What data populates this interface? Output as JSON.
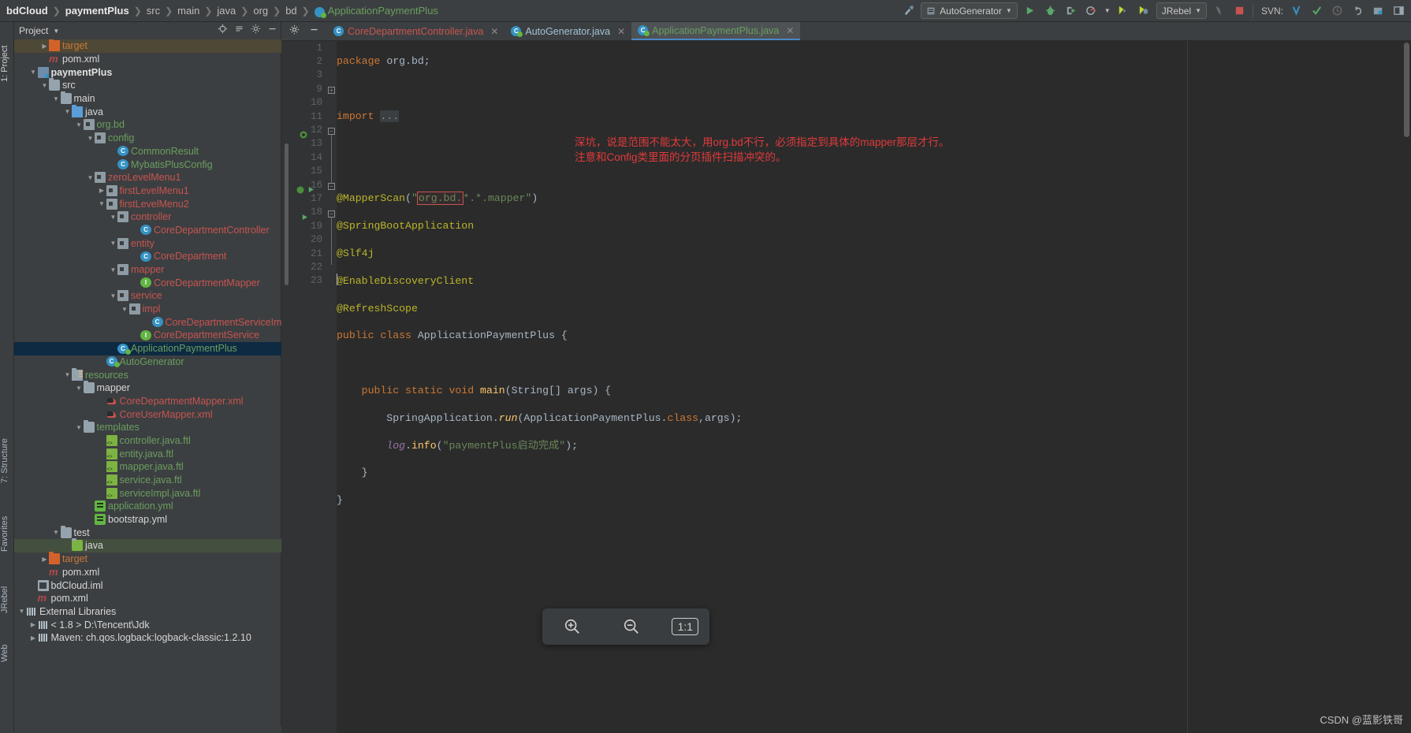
{
  "breadcrumb": {
    "items": [
      {
        "label": "bdCloud",
        "style": "bold"
      },
      {
        "label": "paymentPlus",
        "style": "bold"
      },
      {
        "label": "src",
        "style": "plain"
      },
      {
        "label": "main",
        "style": "plain"
      },
      {
        "label": "java",
        "style": "plain"
      },
      {
        "label": "org",
        "style": "plain"
      },
      {
        "label": "bd",
        "style": "plain"
      },
      {
        "label": "ApplicationPaymentPlus",
        "style": "green-icon"
      }
    ]
  },
  "toolbar": {
    "run_config": "AutoGenerator",
    "jrebel": "JRebel",
    "svn_label": "SVN:",
    "icons": [
      "run-icon",
      "debug-icon",
      "run-with-coverage-icon",
      "profile-icon",
      "jrebel-run-icon",
      "jrebel-debug-icon",
      "attach-icon",
      "stop-icon",
      "svn-update-icon",
      "svn-commit-icon",
      "svn-history-icon",
      "svn-revert-icon",
      "project-structure-icon",
      "layout-icon"
    ]
  },
  "project_panel": {
    "title": "Project",
    "tools": [
      "locate-icon",
      "collapse-all-icon",
      "settings-icon",
      "hide-icon"
    ],
    "tree": [
      {
        "depth": 3,
        "arrow": "collapsed",
        "icon": "folder-orange",
        "label": "target",
        "color": "c-orange",
        "bg": "highlight"
      },
      {
        "depth": 3,
        "arrow": "none",
        "icon": "maven",
        "label": "pom.xml",
        "color": "c-white"
      },
      {
        "depth": 2,
        "arrow": "expanded",
        "icon": "module",
        "label": "paymentPlus",
        "color": "c-bold"
      },
      {
        "depth": 3,
        "arrow": "expanded",
        "icon": "folder",
        "label": "src",
        "color": "c-white"
      },
      {
        "depth": 4,
        "arrow": "expanded",
        "icon": "folder",
        "label": "main",
        "color": "c-white"
      },
      {
        "depth": 5,
        "arrow": "expanded",
        "icon": "folder-blue",
        "label": "java",
        "color": "c-white"
      },
      {
        "depth": 6,
        "arrow": "expanded",
        "icon": "package",
        "label": "org.bd",
        "color": "c-green"
      },
      {
        "depth": 7,
        "arrow": "expanded",
        "icon": "package",
        "label": "config",
        "color": "c-green"
      },
      {
        "depth": 9,
        "arrow": "none",
        "icon": "class",
        "label": "CommonResult",
        "color": "c-green"
      },
      {
        "depth": 9,
        "arrow": "none",
        "icon": "class",
        "label": "MybatisPlusConfig",
        "color": "c-green"
      },
      {
        "depth": 7,
        "arrow": "expanded",
        "icon": "package",
        "label": "zeroLevelMenu1",
        "color": "c-red"
      },
      {
        "depth": 8,
        "arrow": "collapsed",
        "icon": "package",
        "label": "firstLevelMenu1",
        "color": "c-red"
      },
      {
        "depth": 8,
        "arrow": "expanded",
        "icon": "package",
        "label": "firstLevelMenu2",
        "color": "c-red"
      },
      {
        "depth": 9,
        "arrow": "expanded",
        "icon": "package",
        "label": "controller",
        "color": "c-red"
      },
      {
        "depth": 11,
        "arrow": "none",
        "icon": "class",
        "label": "CoreDepartmentController",
        "color": "c-red"
      },
      {
        "depth": 9,
        "arrow": "expanded",
        "icon": "package",
        "label": "entity",
        "color": "c-red"
      },
      {
        "depth": 11,
        "arrow": "none",
        "icon": "class",
        "label": "CoreDepartment",
        "color": "c-red"
      },
      {
        "depth": 9,
        "arrow": "expanded",
        "icon": "package",
        "label": "mapper",
        "color": "c-red"
      },
      {
        "depth": 11,
        "arrow": "none",
        "icon": "interface",
        "label": "CoreDepartmentMapper",
        "color": "c-red"
      },
      {
        "depth": 9,
        "arrow": "expanded",
        "icon": "package",
        "label": "service",
        "color": "c-red"
      },
      {
        "depth": 10,
        "arrow": "expanded",
        "icon": "package",
        "label": "impl",
        "color": "c-red"
      },
      {
        "depth": 12,
        "arrow": "none",
        "icon": "class",
        "label": "CoreDepartmentServiceImpl",
        "color": "c-red"
      },
      {
        "depth": 11,
        "arrow": "none",
        "icon": "interface",
        "label": "CoreDepartmentService",
        "color": "c-red"
      },
      {
        "depth": 9,
        "arrow": "none",
        "icon": "spring-class",
        "label": "ApplicationPaymentPlus",
        "color": "c-green",
        "bg": "selected"
      },
      {
        "depth": 8,
        "arrow": "none",
        "icon": "spring-class",
        "label": "AutoGenerator",
        "color": "c-green"
      },
      {
        "depth": 5,
        "arrow": "expanded",
        "icon": "folder-resources",
        "label": "resources",
        "color": "c-green"
      },
      {
        "depth": 6,
        "arrow": "expanded",
        "icon": "folder",
        "label": "mapper",
        "color": "c-white"
      },
      {
        "depth": 8,
        "arrow": "none",
        "icon": "xml-mapper",
        "label": "CoreDepartmentMapper.xml",
        "color": "c-red"
      },
      {
        "depth": 8,
        "arrow": "none",
        "icon": "xml-mapper",
        "label": "CoreUserMapper.xml",
        "color": "c-red"
      },
      {
        "depth": 6,
        "arrow": "expanded",
        "icon": "folder",
        "label": "templates",
        "color": "c-green"
      },
      {
        "depth": 8,
        "arrow": "none",
        "icon": "ftl",
        "label": "controller.java.ftl",
        "color": "c-green"
      },
      {
        "depth": 8,
        "arrow": "none",
        "icon": "ftl",
        "label": "entity.java.ftl",
        "color": "c-green"
      },
      {
        "depth": 8,
        "arrow": "none",
        "icon": "ftl",
        "label": "mapper.java.ftl",
        "color": "c-green"
      },
      {
        "depth": 8,
        "arrow": "none",
        "icon": "ftl",
        "label": "service.java.ftl",
        "color": "c-green"
      },
      {
        "depth": 8,
        "arrow": "none",
        "icon": "ftl",
        "label": "serviceImpl.java.ftl",
        "color": "c-green"
      },
      {
        "depth": 7,
        "arrow": "none",
        "icon": "yml",
        "label": "application.yml",
        "color": "c-green"
      },
      {
        "depth": 7,
        "arrow": "none",
        "icon": "yml",
        "label": "bootstrap.yml",
        "color": "c-white"
      },
      {
        "depth": 4,
        "arrow": "expanded",
        "icon": "folder",
        "label": "test",
        "color": "c-white"
      },
      {
        "depth": 5,
        "arrow": "none",
        "icon": "folder-green",
        "label": "java",
        "color": "c-white",
        "bg": "greenbg"
      },
      {
        "depth": 3,
        "arrow": "collapsed",
        "icon": "folder-orange",
        "label": "target",
        "color": "c-orange"
      },
      {
        "depth": 3,
        "arrow": "none",
        "icon": "maven",
        "label": "pom.xml",
        "color": "c-white"
      },
      {
        "depth": 2,
        "arrow": "none",
        "icon": "iml",
        "label": "bdCloud.iml",
        "color": "c-white"
      },
      {
        "depth": 2,
        "arrow": "none",
        "icon": "maven",
        "label": "pom.xml",
        "color": "c-white"
      },
      {
        "depth": 1,
        "arrow": "expanded",
        "icon": "library",
        "label": "External Libraries",
        "color": "c-white"
      },
      {
        "depth": 2,
        "arrow": "collapsed",
        "icon": "jdk",
        "label": "< 1.8 > D:\\Tencent\\Jdk",
        "color": "c-white"
      },
      {
        "depth": 2,
        "arrow": "collapsed",
        "icon": "library",
        "label": "Maven: ch.qos.logback:logback-classic:1.2.10",
        "color": "c-white"
      }
    ]
  },
  "editor": {
    "tabs": [
      {
        "label": "CoreDepartmentController.java",
        "icon": "class-icon",
        "color": "red",
        "active": false
      },
      {
        "label": "AutoGenerator.java",
        "icon": "spring-class-icon",
        "color": "blue",
        "active": false
      },
      {
        "label": "ApplicationPaymentPlus.java",
        "icon": "spring-class-icon",
        "color": "green",
        "active": true
      }
    ],
    "tab_tools": [
      "settings-icon",
      "minimize-icon"
    ],
    "line_numbers": [
      "1",
      "2",
      "3",
      "9",
      "10",
      "11",
      "12",
      "13",
      "14",
      "15",
      "16",
      "17",
      "18",
      "19",
      "20",
      "21",
      "22",
      "23"
    ],
    "code_lines": [
      "package org.bd;",
      "",
      "import ...",
      "",
      "",
      "@MapperScan(\"org.bd.*.*.mapper\")",
      "@SpringBootApplication",
      "@Slf4j",
      "@EnableDiscoveryClient",
      "@RefreshScope",
      "public class ApplicationPaymentPlus {",
      "",
      "    public static void main(String[] args) {",
      "        SpringApplication.run(ApplicationPaymentPlus.class,args);",
      "        log.info(\"paymentPlus启动完成\");",
      "    }",
      "}",
      ""
    ],
    "highlighted_token": "org.bd.",
    "annotations": [
      "深坑，说是范围不能太大，用org.bd不行，必须指定到具体的mapper那层才行。",
      "注意和Config类里面的分页插件扫描冲突的。"
    ],
    "annotation_color": "#e03a3a"
  },
  "zoom_toolbar": {
    "buttons": [
      {
        "name": "zoom-in-icon",
        "glyph": "⊕"
      },
      {
        "name": "zoom-out-icon",
        "glyph": "⊖"
      },
      {
        "name": "actual-size-button",
        "glyph": "1:1"
      }
    ]
  },
  "watermark": "CSDN @蓝影铁哥",
  "left_rail": {
    "items": [
      "1: Project",
      "7: Structure",
      "Favorites",
      "JRebel",
      "Web"
    ]
  }
}
